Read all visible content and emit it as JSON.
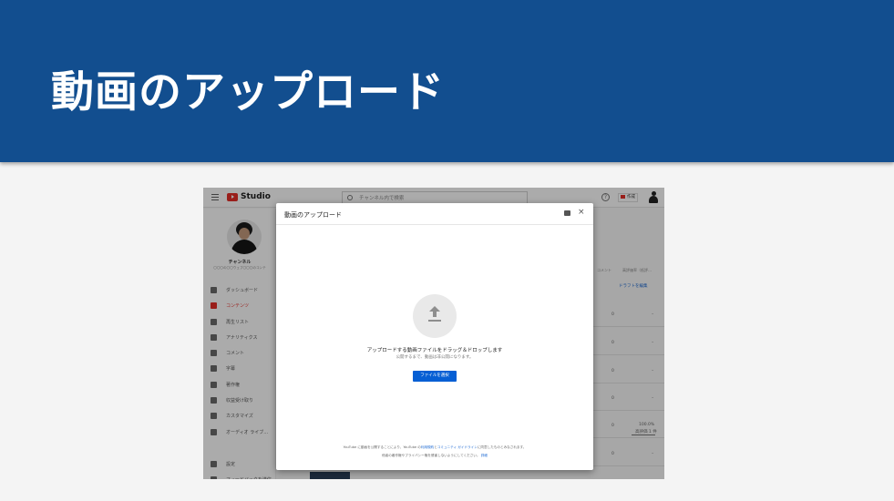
{
  "slide": {
    "title": "動画のアップロード"
  },
  "studio": {
    "logo_text": "Studio",
    "search_placeholder": "チャンネル内で検索",
    "help_icon": "?",
    "create_label": "作成",
    "channel": {
      "name": "チャンネル",
      "subtitle": "〇〇〇の〇〇ウェブ〇〇〇のコンテ"
    },
    "nav": [
      {
        "label": "ダッシュボード",
        "active": false
      },
      {
        "label": "コンテンツ",
        "active": true
      },
      {
        "label": "再生リスト",
        "active": false
      },
      {
        "label": "アナリティクス",
        "active": false
      },
      {
        "label": "コメント",
        "active": false
      },
      {
        "label": "字幕",
        "active": false
      },
      {
        "label": "著作権",
        "active": false
      },
      {
        "label": "収益受け取り",
        "active": false
      },
      {
        "label": "カスタマイズ",
        "active": false
      },
      {
        "label": "オーディオ ライブ…",
        "active": false
      },
      {
        "label": "設定",
        "active": false
      },
      {
        "label": "フィードバックを送信",
        "active": false
      }
    ],
    "background": {
      "col_comments": "コメント",
      "col_likes": "高評価率（低評…",
      "draft_link": "ドラフトを編集",
      "row_values": [
        "0",
        "0",
        "0",
        "0",
        "0",
        "0"
      ],
      "row_dash": "–",
      "like_percent": "100.0%",
      "like_count": "高評価 1 件"
    },
    "dialog": {
      "title": "動画のアップロード",
      "close_label": "×",
      "drop_text": "アップロードする動画ファイルをドラッグ＆ドロップします",
      "sub_text": "公開するまで、動画は非公開になります。",
      "select_button": "ファイルを選択",
      "terms_prefix": "YouTube に動画を公開することにより、YouTube の",
      "terms_link1": "利用規約",
      "terms_mid": "と",
      "terms_link2": "コミュニティ ガイドライン",
      "terms_suffix": "に同意したものとみなされます。",
      "terms_line2": "他者の著作権やプライバシー権を侵害しないようにしてください。",
      "terms_link3": "詳細"
    }
  },
  "colors": {
    "banner": "#124e8f",
    "youtube_red": "#e52d27",
    "link_blue": "#1967d2",
    "button_blue": "#065fd4"
  }
}
